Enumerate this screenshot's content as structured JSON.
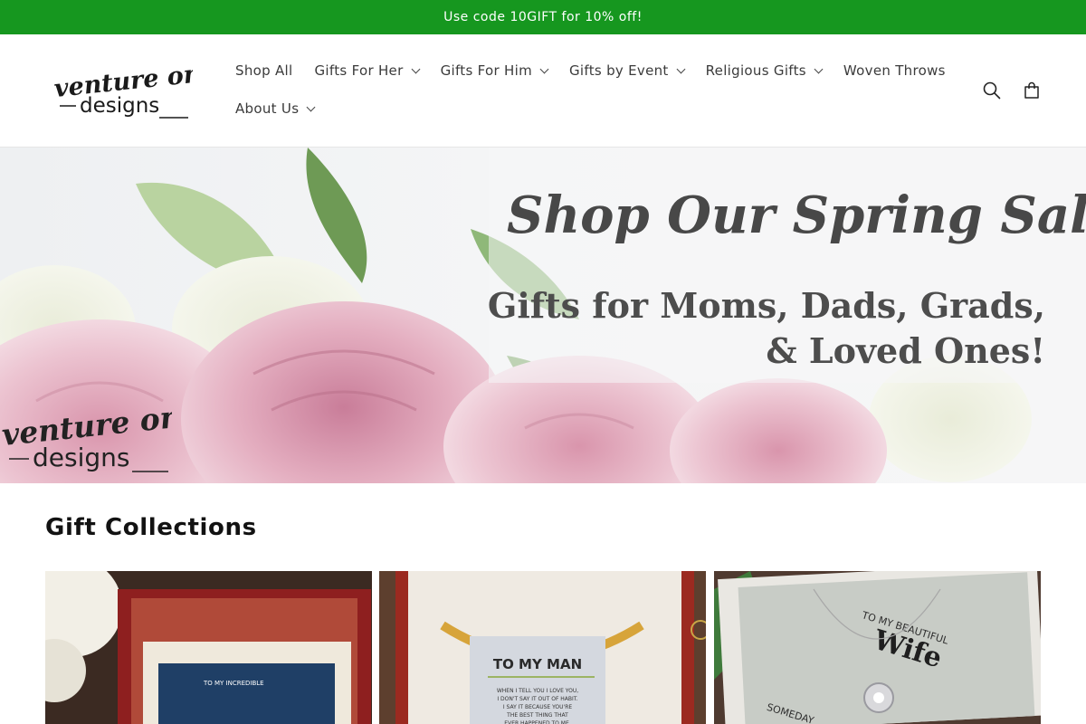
{
  "announcement": {
    "text": "Use code 10GIFT for 10% off!"
  },
  "brand": {
    "logo_alt": "venture on designs"
  },
  "nav": {
    "items": [
      {
        "label": "Shop All",
        "dropdown": false
      },
      {
        "label": "Gifts For Her",
        "dropdown": true
      },
      {
        "label": "Gifts For Him",
        "dropdown": true
      },
      {
        "label": "Gifts by Event",
        "dropdown": true
      },
      {
        "label": "Religious Gifts",
        "dropdown": true
      },
      {
        "label": "Woven Throws",
        "dropdown": false
      },
      {
        "label": "About Us",
        "dropdown": true
      }
    ]
  },
  "header_icons": [
    "search-icon",
    "cart-icon"
  ],
  "hero": {
    "title": "Shop Our Spring Sale",
    "subtitle_line1": "Gifts for Moms, Dads, Grads,",
    "subtitle_line2": "& Loved Ones!",
    "logo_alt": "venture on designs"
  },
  "collections": {
    "heading": "Gift Collections",
    "cards": [
      {
        "card_text": "TO MY INCREDIBLE"
      },
      {
        "card_title": "TO MY MAN",
        "card_text": "WHEN I TELL YOU I LOVE YOU, I DON'T SAY IT OUT OF HABIT. I SAY IT BECAUSE YOU'RE THE BEST THING THAT EVER HAPPENED TO ME."
      },
      {
        "card_line1": "TO MY BEAUTIFUL",
        "card_line2": "Wife",
        "card_text": "SOMEDAY"
      }
    ]
  },
  "colors": {
    "announcement_bg": "#16971f",
    "text": "#121212"
  }
}
